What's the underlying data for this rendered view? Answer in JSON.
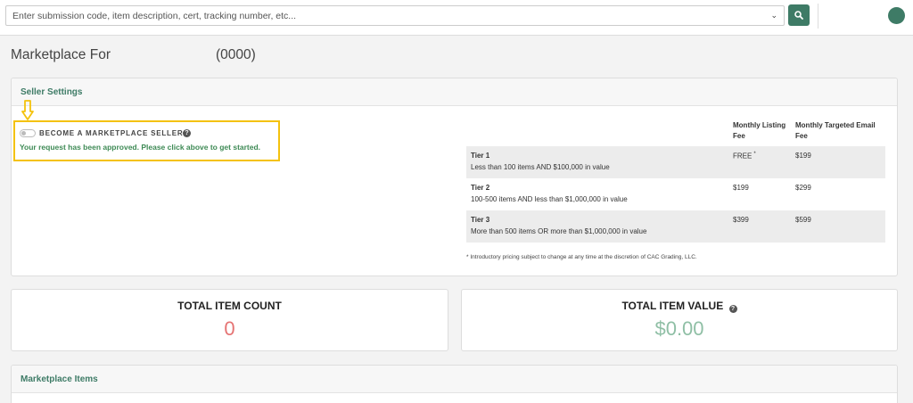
{
  "search": {
    "placeholder": "Enter submission code, item description, cert, tracking number, etc..."
  },
  "page": {
    "title": "Marketplace For",
    "code": "(0000)"
  },
  "seller_settings": {
    "header": "Seller Settings",
    "toggle_label": "BECOME A MARKETPLACE SELLER?",
    "toggle_on": false,
    "approved_message": "Your request has been approved. Please click above to get started."
  },
  "pricing": {
    "col_listing_fee": "Monthly Listing Fee",
    "col_email_fee": "Monthly Targeted Email Fee",
    "tiers": [
      {
        "name": "Tier 1",
        "description": "Less than 100 items AND $100,000 in value",
        "listing_fee": "FREE",
        "listing_fee_mark": "*",
        "email_fee": "$199"
      },
      {
        "name": "Tier 2",
        "description": "100-500 items AND less than $1,000,000 in value",
        "listing_fee": "$199",
        "listing_fee_mark": "",
        "email_fee": "$299"
      },
      {
        "name": "Tier 3",
        "description": "More than 500 items OR more than $1,000,000 in value",
        "listing_fee": "$399",
        "listing_fee_mark": "",
        "email_fee": "$599"
      }
    ],
    "footnote": "* Introductory pricing subject to change at any time at the discretion of CAC Grading, LLC."
  },
  "stats": {
    "count_label": "TOTAL ITEM COUNT",
    "count_value": "0",
    "value_label": "TOTAL ITEM VALUE",
    "value_value": "$0.00"
  },
  "marketplace_items": {
    "header": "Marketplace Items"
  },
  "colors": {
    "accent": "#3e7b66",
    "highlight": "#f4c20d",
    "count_value": "#e57373",
    "value_value": "#8fbfa5"
  }
}
